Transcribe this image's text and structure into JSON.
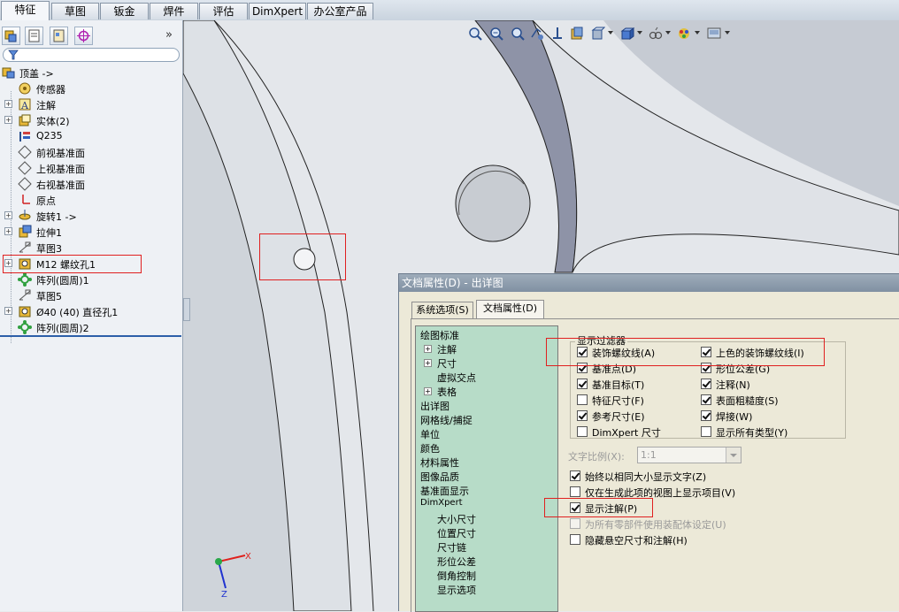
{
  "tabs": [
    "特征",
    "草图",
    "钣金",
    "焊件",
    "评估",
    "DimXpert",
    "办公室产品"
  ],
  "tree": {
    "root": "顶盖 ->",
    "items": [
      {
        "label": "传感器",
        "exp": false
      },
      {
        "label": "注解",
        "exp": true
      },
      {
        "label": "实体(2)",
        "exp": true
      },
      {
        "label": "Q235",
        "exp": false
      },
      {
        "label": "前视基准面",
        "exp": false
      },
      {
        "label": "上视基准面",
        "exp": false
      },
      {
        "label": "右视基准面",
        "exp": false
      },
      {
        "label": "原点",
        "exp": false
      },
      {
        "label": "旋转1 ->",
        "exp": true
      },
      {
        "label": "拉伸1",
        "exp": true
      },
      {
        "label": "草图3",
        "exp": false
      },
      {
        "label": "M12 螺纹孔1",
        "exp": true
      },
      {
        "label": "阵列(圆周)1",
        "exp": false
      },
      {
        "label": "草图5",
        "exp": false
      },
      {
        "label": "Ø40 (40) 直径孔1",
        "exp": true
      },
      {
        "label": "阵列(圆周)2",
        "exp": false
      }
    ]
  },
  "axes": {
    "x": "X",
    "y": "Y",
    "z": "Z"
  },
  "dialog": {
    "title": "文档属性(D) - 出详图",
    "tab_system": "系统选项(S)",
    "tab_document": "文档属性(D)",
    "nav": [
      {
        "label": "绘图标准",
        "indent": 0,
        "exp": false
      },
      {
        "label": "注解",
        "indent": 1,
        "exp": true
      },
      {
        "label": "尺寸",
        "indent": 1,
        "exp": true
      },
      {
        "label": "虚拟交点",
        "indent": 1,
        "exp": false
      },
      {
        "label": "表格",
        "indent": 1,
        "exp": true
      },
      {
        "label": "出详图",
        "indent": 0,
        "exp": false
      },
      {
        "label": "网格线/捕捉",
        "indent": 0,
        "exp": false
      },
      {
        "label": "单位",
        "indent": 0,
        "exp": false
      },
      {
        "label": "颜色",
        "indent": 0,
        "exp": false
      },
      {
        "label": "材料属性",
        "indent": 0,
        "exp": false
      },
      {
        "label": "图像品质",
        "indent": 0,
        "exp": false
      },
      {
        "label": "基准面显示",
        "indent": 0,
        "exp": false
      },
      {
        "label": "DimXpert",
        "indent": 0,
        "exp": false
      },
      {
        "label": "大小尺寸",
        "indent": 2,
        "exp": false
      },
      {
        "label": "位置尺寸",
        "indent": 2,
        "exp": false
      },
      {
        "label": "尺寸链",
        "indent": 2,
        "exp": false
      },
      {
        "label": "形位公差",
        "indent": 2,
        "exp": false
      },
      {
        "label": "倒角控制",
        "indent": 2,
        "exp": false
      },
      {
        "label": "显示选项",
        "indent": 2,
        "exp": false
      }
    ],
    "filter_title": "显示过滤器",
    "filters_left": [
      {
        "label": "装饰螺纹线(A)",
        "checked": true
      },
      {
        "label": "基准点(D)",
        "checked": true
      },
      {
        "label": "基准目标(T)",
        "checked": true
      },
      {
        "label": "特征尺寸(F)",
        "checked": false
      },
      {
        "label": "参考尺寸(E)",
        "checked": true
      },
      {
        "label": "DimXpert 尺寸",
        "checked": false
      }
    ],
    "filters_right": [
      {
        "label": "上色的装饰螺纹线(I)",
        "checked": true
      },
      {
        "label": "形位公差(G)",
        "checked": true
      },
      {
        "label": "注释(N)",
        "checked": true
      },
      {
        "label": "表面粗糙度(S)",
        "checked": true
      },
      {
        "label": "焊接(W)",
        "checked": true
      },
      {
        "label": "显示所有类型(Y)",
        "checked": false
      }
    ],
    "text_scale_label": "文字比例(X):",
    "text_scale_value": "1:1",
    "options": [
      {
        "label": "始终以相同大小显示文字(Z)",
        "checked": true,
        "disabled": false
      },
      {
        "label": "仅在生成此项的视图上显示项目(V)",
        "checked": false,
        "disabled": false
      },
      {
        "label": "显示注解(P)",
        "checked": true,
        "disabled": false
      },
      {
        "label": "为所有零部件使用装配体设定(U)",
        "checked": false,
        "disabled": true
      },
      {
        "label": "隐藏悬空尺寸和注解(H)",
        "checked": false,
        "disabled": false
      }
    ]
  }
}
